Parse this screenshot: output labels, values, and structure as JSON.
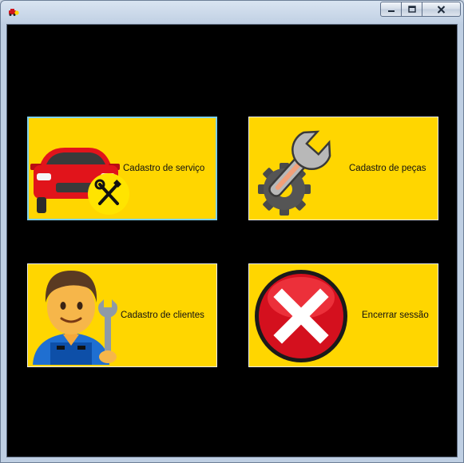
{
  "window": {
    "app_icon": "car-tool-icon",
    "controls": {
      "minimize": "minimize-icon",
      "maximize": "maximize-icon",
      "close": "close-icon"
    }
  },
  "tiles": {
    "service": {
      "label": "Cadastro de serviço",
      "icon": "car-tools-icon"
    },
    "parts": {
      "label": "Cadastro de peças",
      "icon": "wrench-gear-icon"
    },
    "clients": {
      "label": "Cadastro de clientes",
      "icon": "mechanic-icon"
    },
    "logout": {
      "label": "Encerrar sessão",
      "icon": "red-x-icon"
    }
  },
  "colors": {
    "tile_background": "#ffd600",
    "client_background": "#000000",
    "focus_border": "#7ed0ee"
  }
}
